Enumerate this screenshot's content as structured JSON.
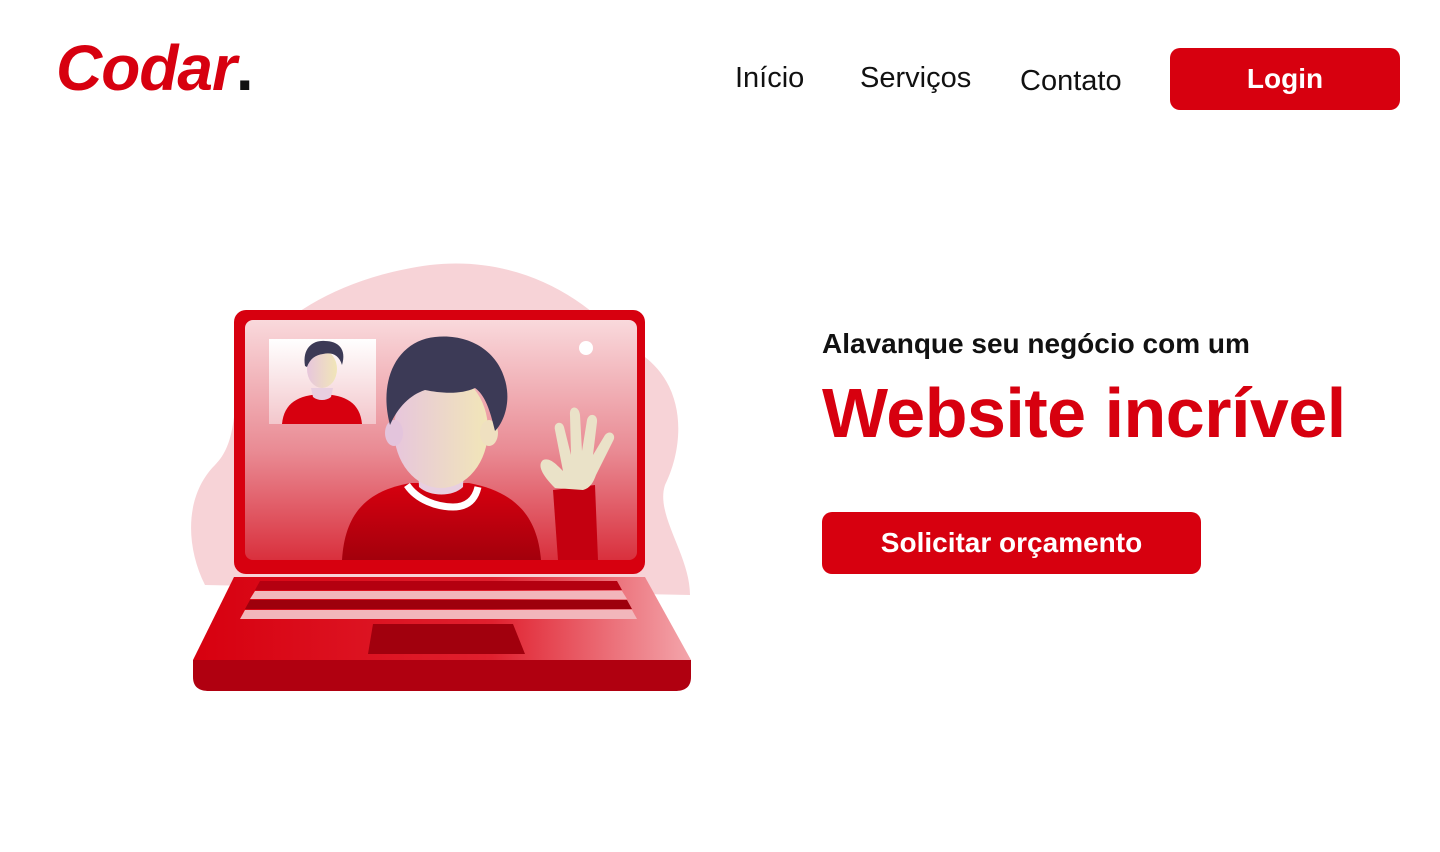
{
  "header": {
    "logo_text": "Codar",
    "logo_dot": ".",
    "nav": {
      "inicio": "Início",
      "servicos": "Serviços",
      "contato": "Contato"
    },
    "login_label": "Login"
  },
  "hero": {
    "subtitle": "Alavanque seu negócio com um",
    "title": "Website incrível",
    "cta_label": "Solicitar orçamento",
    "illustration": "laptop-video-call-illustration"
  },
  "colors": {
    "brand": "#d7000f",
    "text": "#111111",
    "background": "#ffffff",
    "blob": "#f7d3d7"
  }
}
